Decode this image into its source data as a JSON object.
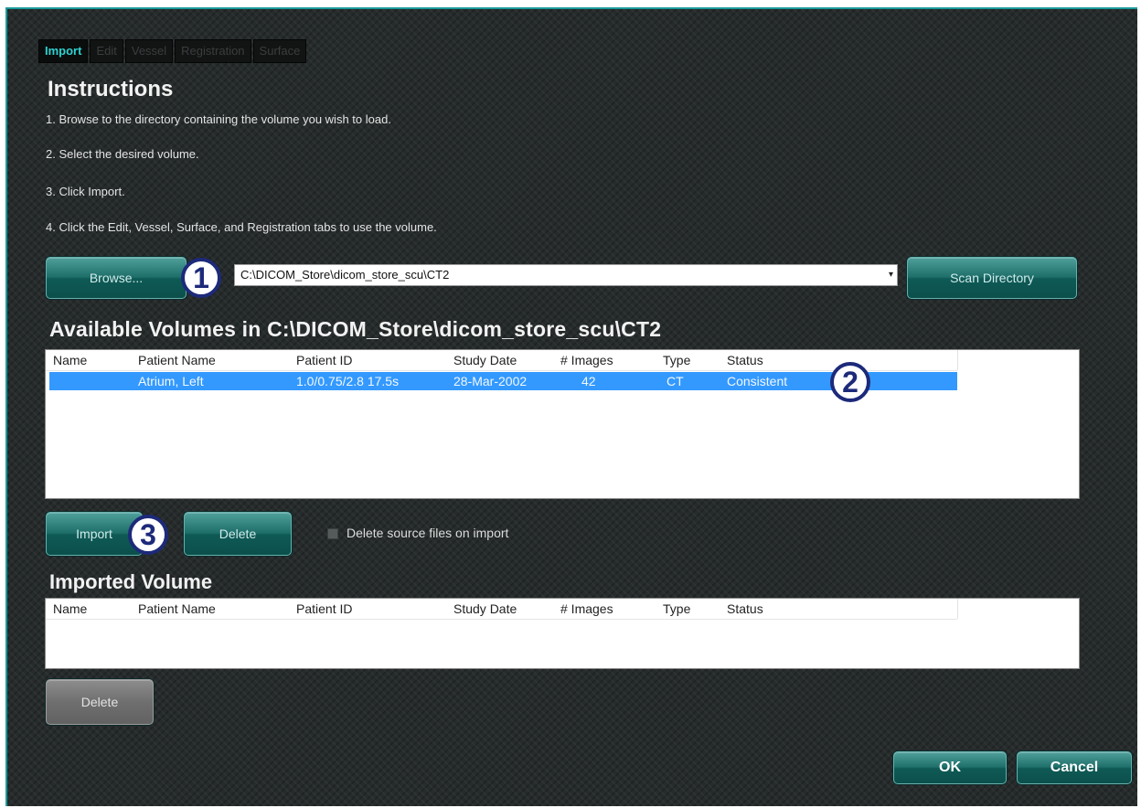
{
  "tabs": [
    {
      "label": "Import",
      "active": true
    },
    {
      "label": "Edit",
      "active": false
    },
    {
      "label": "Vessel",
      "active": false
    },
    {
      "label": "Registration",
      "active": false
    },
    {
      "label": "Surface",
      "active": false
    }
  ],
  "instructions": {
    "title": "Instructions",
    "steps": [
      "1.  Browse to the directory containing the volume you wish to load.",
      "2.  Select the desired volume.",
      "3.  Click Import.",
      "4.  Click the Edit, Vessel, Surface, and Registration tabs to use the volume."
    ]
  },
  "browse": {
    "button_label": "Browse...",
    "path_value": "C:\\DICOM_Store\\dicom_store_scu\\CT2",
    "dropdown_icon": "chevron-down-icon",
    "scan_label": "Scan Directory"
  },
  "callouts": {
    "one": "1",
    "two": "2",
    "three": "3"
  },
  "available": {
    "title": "Available Volumes in C:\\DICOM_Store\\dicom_store_scu\\CT2",
    "columns": [
      "Name",
      "Patient Name",
      "Patient ID",
      "Study Date",
      "# Images",
      "Type",
      "Status"
    ],
    "rows": [
      {
        "name": "",
        "patient_name": "Atrium, Left",
        "patient_id": "1.0/0.75/2.8 17.5s",
        "study_date": "28-Mar-2002",
        "images": "42",
        "type": "CT",
        "status": "Consistent",
        "selected": true
      }
    ]
  },
  "actions": {
    "import_label": "Import",
    "delete_label": "Delete",
    "delete_source_label": "Delete source files on import",
    "delete_source_checked": false
  },
  "imported": {
    "title": "Imported Volume",
    "columns": [
      "Name",
      "Patient Name",
      "Patient ID",
      "Study Date",
      "# Images",
      "Type",
      "Status"
    ],
    "delete_label": "Delete"
  },
  "footer": {
    "ok_label": "OK",
    "cancel_label": "Cancel"
  },
  "colors": {
    "accent": "#2fd1d1",
    "selection": "#3399ff",
    "button_teal": "#1e6e69",
    "callout": "#1d2a7a"
  }
}
